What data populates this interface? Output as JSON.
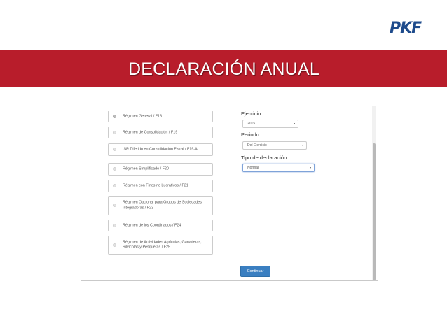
{
  "brand": {
    "logo_text": "PKF",
    "logo_color": "#1e4b8c",
    "banner_color": "#b81d2b"
  },
  "banner": {
    "title": "DECLARACIÓN  ANUAL"
  },
  "regimes": [
    {
      "label": "Régimen General / F18",
      "selected": true
    },
    {
      "label": "Régimen de Consolidación / F19",
      "selected": false
    },
    {
      "label": "ISR Diferido en Consolidación Fiscal / F19-A",
      "selected": false
    },
    {
      "label": "Régimen Simplificado / F20",
      "selected": false
    },
    {
      "label": "Régimen con Fines no Lucrativos / F21",
      "selected": false
    },
    {
      "label": "Régimen Opcional para Grupos de Sociedades. Integradoras / F23",
      "selected": false
    },
    {
      "label": "Régimen de los Coordinados / F24",
      "selected": false
    },
    {
      "label": "Régimen de Actividades Agrícolas, Ganaderas, Silvícolas y Pesqueras / F25",
      "selected": false
    }
  ],
  "form": {
    "ejercicio": {
      "label": "Ejercicio",
      "value": "2015",
      "caret": "▾"
    },
    "periodo": {
      "label": "Periodo",
      "value": "Del Ejercicio",
      "caret": "▾"
    },
    "tipo": {
      "label": "Tipo de declaración",
      "value": "Normal",
      "caret": "▾"
    }
  },
  "actions": {
    "continue_label": "Continuar",
    "accent": "#3a7fc1"
  }
}
